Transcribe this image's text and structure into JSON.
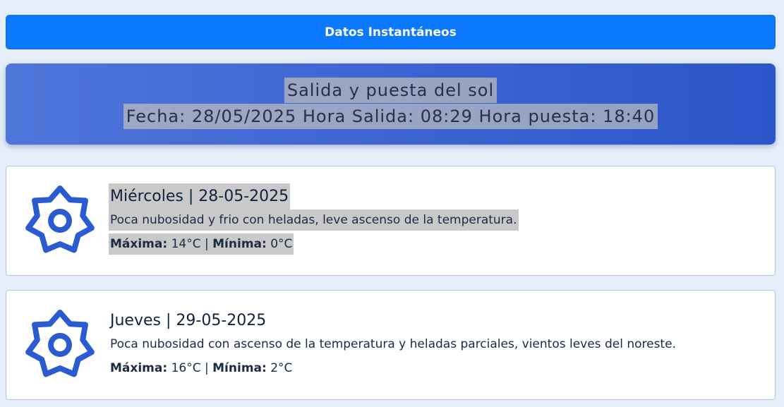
{
  "header_button": {
    "label": "Datos Instantáneos"
  },
  "sun_panel": {
    "title": "Salida y puesta del sol",
    "date_label": "Fecha:",
    "date_value": "28/05/2025",
    "sunrise_label": "Hora Salida:",
    "sunrise_value": "08:29",
    "sunset_label": "Hora puesta:",
    "sunset_value": "18:40"
  },
  "forecast": [
    {
      "day_name": "Miércoles",
      "separator": "|",
      "date": "28-05-2025",
      "description": "Poca nubosidad y frio con heladas, leve ascenso de la temperatura.",
      "max_label": "Máxima:",
      "max_value": "14°C",
      "min_label": "Mínima:",
      "min_value": "0°C",
      "icon": "gear-icon"
    },
    {
      "day_name": "Jueves",
      "separator": "|",
      "date": "29-05-2025",
      "description": "Poca nubosidad con ascenso de la temperatura y heladas parciales, vientos leves del noreste.",
      "max_label": "Máxima:",
      "max_value": "16°C",
      "min_label": "Mínima:",
      "min_value": "2°C",
      "icon": "gear-icon"
    }
  ],
  "colors": {
    "page_bg": "#e6eff9",
    "button_blue": "#0b78fd",
    "panel_gradient_start": "#4f76d9",
    "panel_gradient_end": "#2c55c9",
    "icon_blue": "#2b5bd1",
    "card_border": "#a9c6ea",
    "highlight_gray": "#c9c9c9"
  }
}
